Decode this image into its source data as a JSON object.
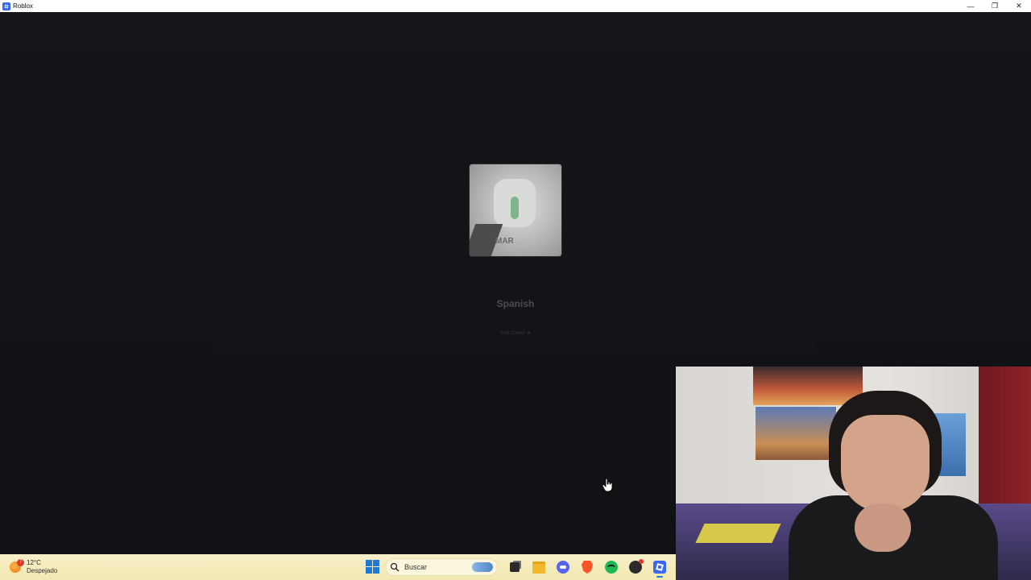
{
  "window": {
    "title": "Roblox",
    "minimize_glyph": "—",
    "restore_glyph": "❐",
    "close_glyph": "✕"
  },
  "game": {
    "name": "Spanish",
    "subtitle": "Vest Center ★",
    "thumbnail_text": "MAR"
  },
  "taskbar": {
    "weather": {
      "temperature": "12°C",
      "description": "Despejado",
      "badge": "7"
    },
    "search": {
      "label": "Buscar"
    },
    "icons": [
      {
        "name": "start-icon"
      },
      {
        "name": "task-view-icon"
      },
      {
        "name": "file-explorer-icon"
      },
      {
        "name": "discord-icon"
      },
      {
        "name": "brave-icon"
      },
      {
        "name": "spotify-icon"
      },
      {
        "name": "obs-icon"
      },
      {
        "name": "roblox-icon",
        "active": true
      }
    ]
  },
  "colors": {
    "background": "#111215",
    "taskbar": "#f2e8b2",
    "accent": "#1d78d6",
    "roblox": "#3a68f5"
  }
}
